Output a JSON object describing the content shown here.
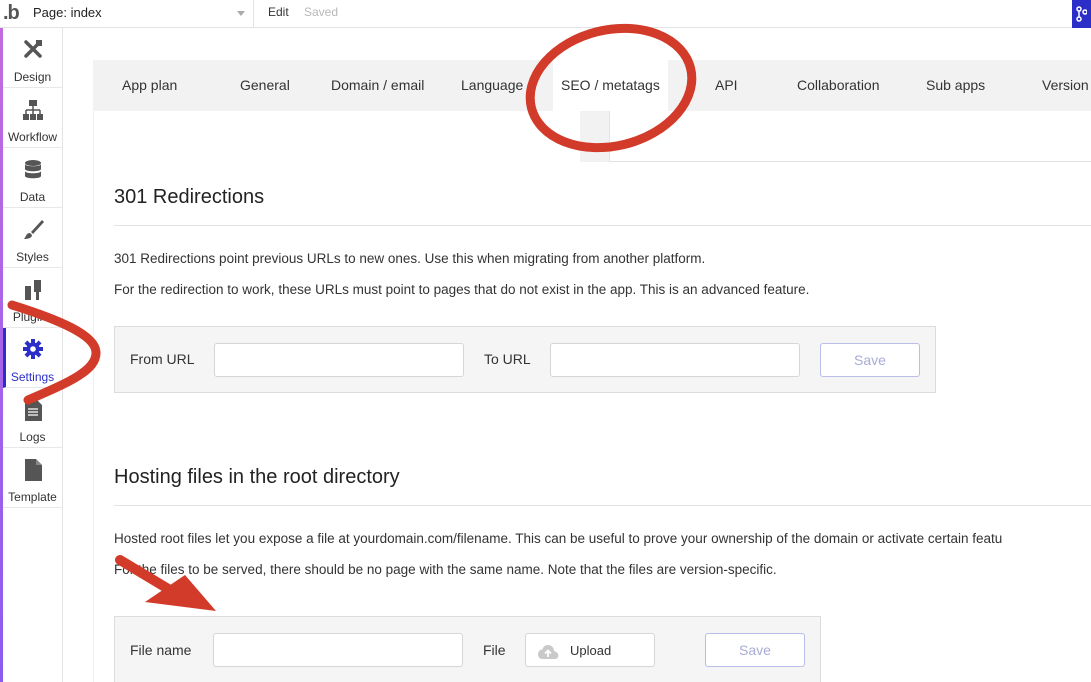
{
  "topbar": {
    "logo": ".b",
    "page_label": "Page: index",
    "edit_label": "Edit",
    "saved_label": "Saved"
  },
  "sidebar": {
    "items": [
      {
        "label": "Design",
        "icon": "design-icon"
      },
      {
        "label": "Workflow",
        "icon": "workflow-icon"
      },
      {
        "label": "Data",
        "icon": "database-icon"
      },
      {
        "label": "Styles",
        "icon": "brush-icon"
      },
      {
        "label": "Plugins",
        "icon": "plugin-icon"
      },
      {
        "label": "Settings",
        "icon": "gear-icon",
        "active": true
      },
      {
        "label": "Logs",
        "icon": "document-icon"
      },
      {
        "label": "Template",
        "icon": "template-icon"
      }
    ]
  },
  "tabs": [
    {
      "label": "App plan"
    },
    {
      "label": "General"
    },
    {
      "label": "Domain / email"
    },
    {
      "label": "Language"
    },
    {
      "label": "SEO / metatags",
      "active": true
    },
    {
      "label": "API"
    },
    {
      "label": "Collaboration"
    },
    {
      "label": "Sub apps"
    },
    {
      "label": "Version"
    }
  ],
  "redirections": {
    "title": "301 Redirections",
    "desc1": "301 Redirections point previous URLs to new ones. Use this when migrating from another platform.",
    "desc2": "For the redirection to work, these URLs must point to pages that do not exist in the app. This is an advanced feature.",
    "from_label": "From URL",
    "from_value": "",
    "to_label": "To URL",
    "to_value": "",
    "save_label": "Save"
  },
  "hosting": {
    "title": "Hosting files in the root directory",
    "desc1": "Hosted root files let you expose a file at yourdomain.com/filename. This can be useful to prove your ownership of the domain or activate certain featu",
    "desc2": "For the files to be served, there should be no page with the same name. Note that the files are version-specific.",
    "file_name_label": "File name",
    "file_name_value": "",
    "file_label": "File",
    "upload_label": "Upload",
    "save_label": "Save"
  },
  "colors": {
    "accent": "#2b2fc8",
    "annotation": "#d23a2a"
  }
}
